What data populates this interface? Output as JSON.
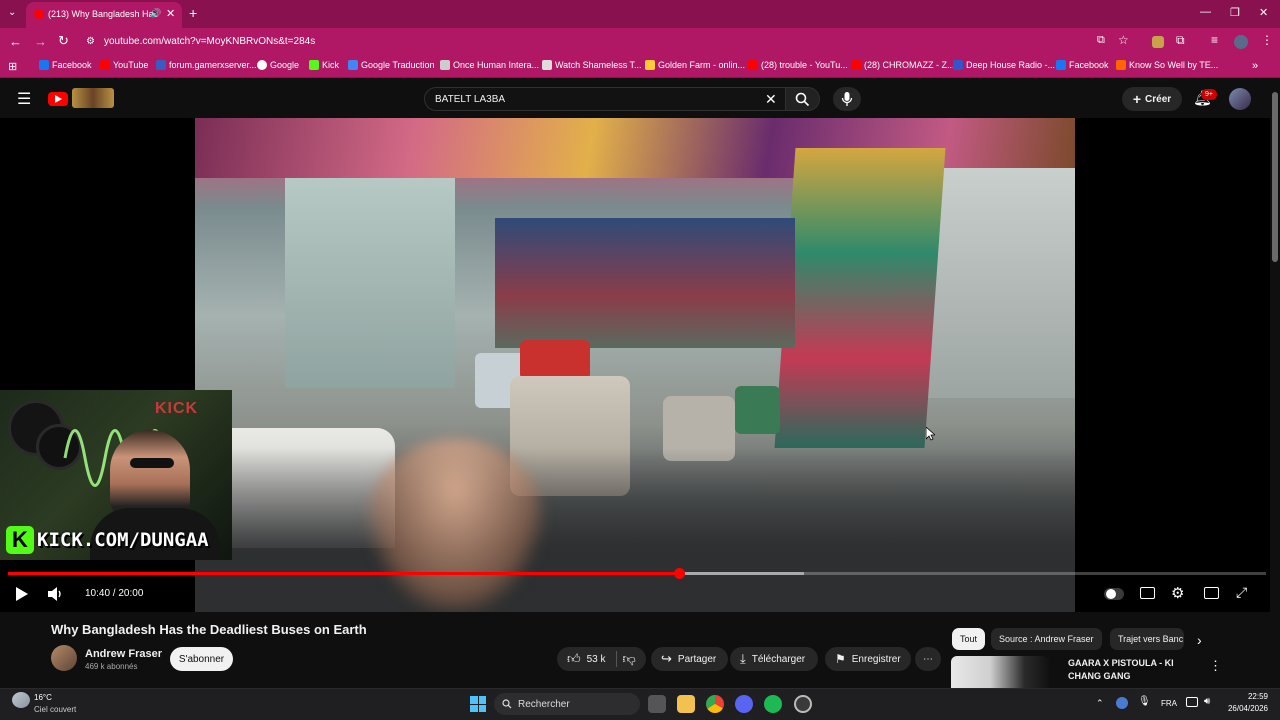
{
  "browser": {
    "tab_title": "(213) Why Bangladesh Has",
    "url": "youtube.com/watch?v=MoyKNBRvONs&t=284s",
    "bookmarks": [
      {
        "label": "Facebook",
        "color": "#1877f2"
      },
      {
        "label": "YouTube",
        "color": "#ff0000"
      },
      {
        "label": "forum.gamerxserver...",
        "color": "#3a5bbf"
      },
      {
        "label": "Google",
        "color": "#ffffff"
      },
      {
        "label": "Kick",
        "color": "#53fc18"
      },
      {
        "label": "Google Traduction",
        "color": "#4285f4"
      },
      {
        "label": "Once Human Intera...",
        "color": "#cccccc"
      },
      {
        "label": "Watch Shameless T...",
        "color": "#dddddd"
      },
      {
        "label": "Golden Farm - onlin...",
        "color": "#ffcc33"
      },
      {
        "label": "(28) trouble - YouTu...",
        "color": "#ff0000"
      },
      {
        "label": "(28) CHROMAZZ - Z...",
        "color": "#ff0000"
      },
      {
        "label": "Deep House Radio -...",
        "color": "#3355cc"
      },
      {
        "label": "Facebook",
        "color": "#1877f2"
      },
      {
        "label": "Know So Well by TE...",
        "color": "#ff6600"
      }
    ],
    "more_bookmarks": "»"
  },
  "youtube": {
    "search_value": "BATELT LA3BA",
    "create_label": "Créer",
    "notif_badge": "9+",
    "video": {
      "time": "10:40 / 20:00",
      "played_fraction": 0.533,
      "buffered_fraction": 0.633,
      "overlay_text": "KICK.COM/DUNGAA",
      "neon_sign": "KICK"
    },
    "title": "Why Bangladesh Has the Deadliest Buses on Earth",
    "channel": "Andrew Fraser",
    "subscribers": "469 k abonnés",
    "subscribe_label": "S'abonner",
    "likes": "53 k",
    "share_label": "Partager",
    "download_label": "Télécharger",
    "save_label": "Enregistrer",
    "chips": [
      "Tout",
      "Source : Andrew Fraser",
      "Trajet vers Banc"
    ],
    "recommended": {
      "title_line1": "GAARA X PISTOULA - KI",
      "title_line2": "CHANG GANG"
    }
  },
  "taskbar": {
    "weather_temp": "16°C",
    "weather_desc": "Ciel couvert",
    "search_label": "Rechercher",
    "language": "FRA",
    "time": "22:59",
    "date": "26/04/2026"
  },
  "colors": {
    "chrome_dark": "#8a1150",
    "chrome": "#b01866",
    "youtube_red": "#ff0000",
    "background": "#0f0f0f"
  }
}
